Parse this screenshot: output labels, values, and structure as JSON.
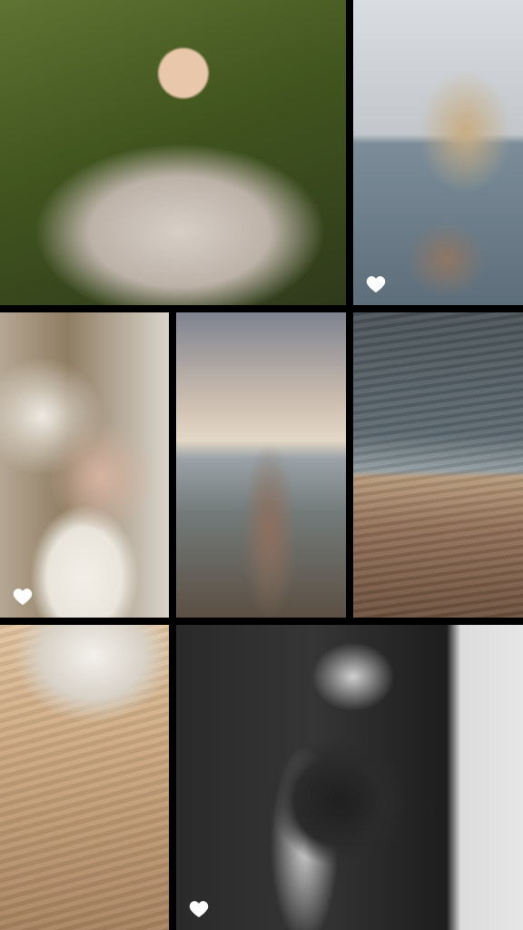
{
  "gallery": {
    "background_color": "#000000",
    "heart_color": "#ffffff",
    "tiles": [
      {
        "subject": "bride-sitting-on-grass-with-bouquet",
        "liked_icon": false
      },
      {
        "subject": "couple-embracing-at-sea-sunset",
        "liked_icon": true
      },
      {
        "subject": "bride-lying-on-fluffy-blanket",
        "liked_icon": true
      },
      {
        "subject": "couple-hugging-on-beach-at-sunset",
        "liked_icon": false
      },
      {
        "subject": "couple-on-sand-dunes",
        "liked_icon": false
      },
      {
        "subject": "bare-feet-on-sand-with-dress",
        "liked_icon": false
      },
      {
        "subject": "black-and-white-studio-couple-portrait",
        "liked_icon": true
      }
    ]
  }
}
